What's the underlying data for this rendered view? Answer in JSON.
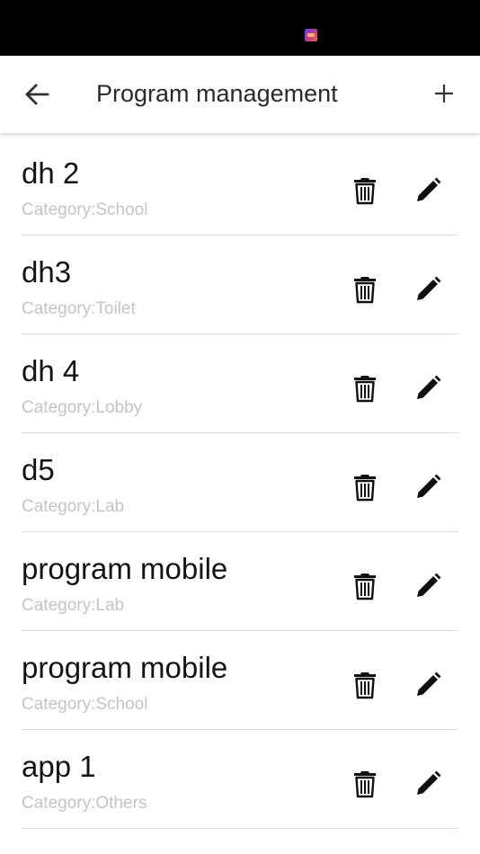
{
  "app_bar": {
    "title": "Program management",
    "back_icon": "arrow-left-icon",
    "add_icon": "plus-icon"
  },
  "programs": [
    {
      "name": "dh 2",
      "category": "Category:School"
    },
    {
      "name": "dh3",
      "category": "Category:Toilet"
    },
    {
      "name": "dh 4",
      "category": "Category:Lobby"
    },
    {
      "name": "d5",
      "category": "Category:Lab"
    },
    {
      "name": "program mobile",
      "category": "Category:Lab"
    },
    {
      "name": "program mobile",
      "category": "Category:School"
    },
    {
      "name": "app 1",
      "category": "Category:Others"
    }
  ],
  "row_icons": {
    "delete": "trash-icon",
    "edit": "pencil-icon"
  },
  "colors": {
    "status_bar": "#000000",
    "category_text": "#c4c4c4",
    "divider": "#dcdcdc"
  }
}
